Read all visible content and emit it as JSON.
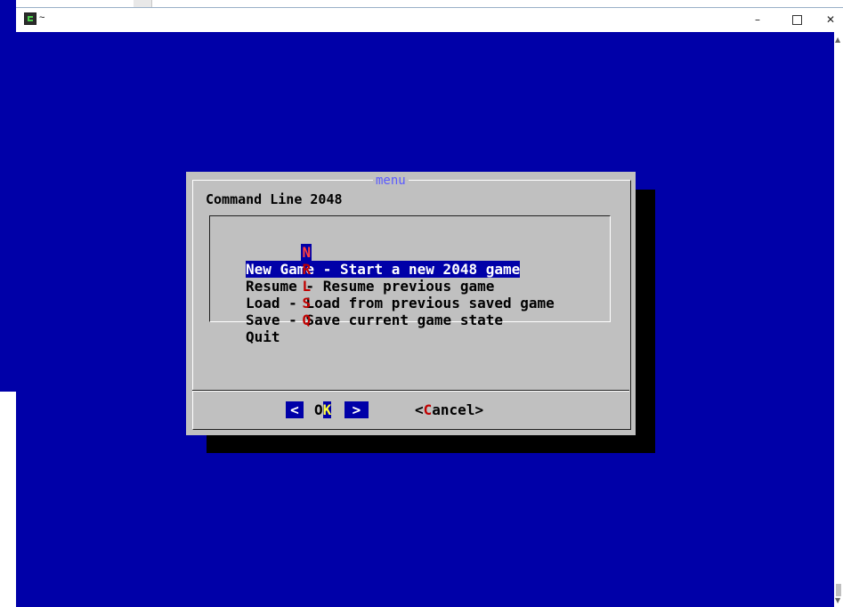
{
  "window": {
    "title": "~",
    "minimize_glyph": "–",
    "close_glyph": "✕"
  },
  "dialog": {
    "title": "menu",
    "header": "Command Line 2048",
    "items": [
      {
        "key": "N",
        "label": "New Game - Start a new 2048 game",
        "selected": true
      },
      {
        "key": "R",
        "label": "Resume - Resume previous game",
        "selected": false
      },
      {
        "key": "L",
        "label": "Load - Load from previous saved game",
        "selected": false
      },
      {
        "key": "S",
        "label": "Save - Save current game state",
        "selected": false
      },
      {
        "key": "Q",
        "label": "Quit",
        "selected": false
      }
    ],
    "ok_button": {
      "left": "<",
      "pre": "O",
      "hot": "K",
      "right": ">"
    },
    "cancel_button": {
      "pre": "<",
      "hot": "C",
      "post": "ancel>"
    }
  },
  "colors": {
    "terminal_bg": "#0000a8",
    "dialog_bg": "#c0c0c0",
    "hotkey": "#c00000",
    "title_text": "#5a5aff"
  }
}
